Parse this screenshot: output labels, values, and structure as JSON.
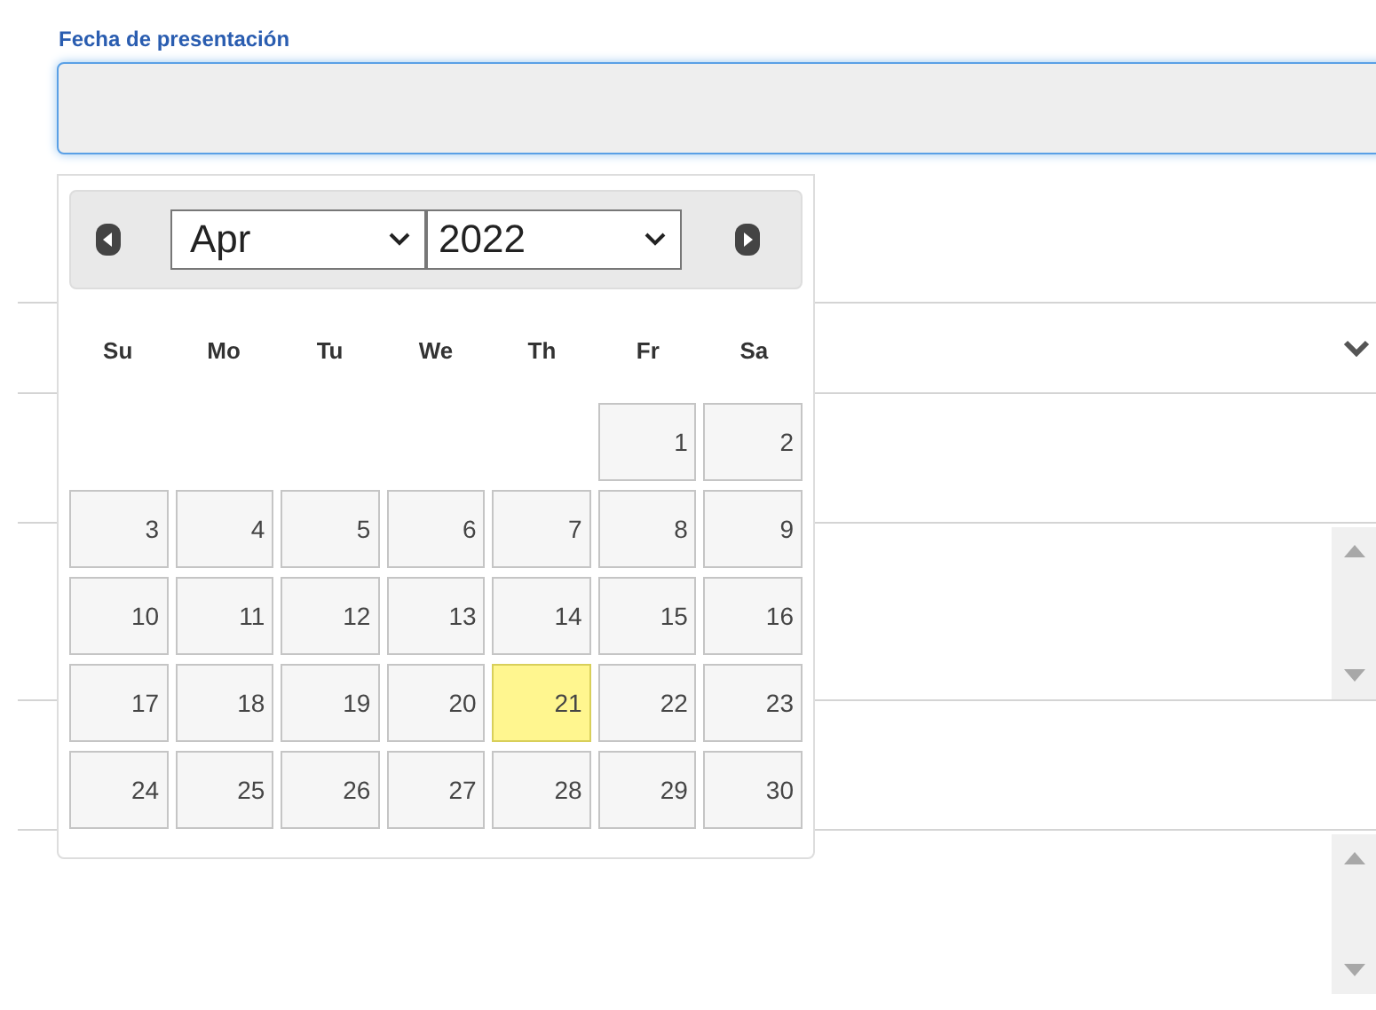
{
  "field": {
    "label": "Fecha de presentación"
  },
  "datepicker": {
    "month": "Apr",
    "year": "2022",
    "weekdays": [
      "Su",
      "Mo",
      "Tu",
      "We",
      "Th",
      "Fr",
      "Sa"
    ],
    "weeks": [
      [
        {
          "day": "1",
          "selected": false
        },
        {
          "day": "2",
          "selected": false
        }
      ],
      [
        {
          "day": "3",
          "selected": false
        },
        {
          "day": "4",
          "selected": false
        },
        {
          "day": "5",
          "selected": false
        },
        {
          "day": "6",
          "selected": false
        },
        {
          "day": "7",
          "selected": false
        },
        {
          "day": "8",
          "selected": false
        },
        {
          "day": "9",
          "selected": false
        }
      ],
      [
        {
          "day": "10",
          "selected": false
        },
        {
          "day": "11",
          "selected": false
        },
        {
          "day": "12",
          "selected": false
        },
        {
          "day": "13",
          "selected": false
        },
        {
          "day": "14",
          "selected": false
        },
        {
          "day": "15",
          "selected": false
        },
        {
          "day": "16",
          "selected": false
        }
      ],
      [
        {
          "day": "17",
          "selected": false
        },
        {
          "day": "18",
          "selected": false
        },
        {
          "day": "19",
          "selected": false
        },
        {
          "day": "20",
          "selected": false
        },
        {
          "day": "21",
          "selected": true
        },
        {
          "day": "22",
          "selected": false
        },
        {
          "day": "23",
          "selected": false
        }
      ],
      [
        {
          "day": "24",
          "selected": false
        },
        {
          "day": "25",
          "selected": false
        },
        {
          "day": "26",
          "selected": false
        },
        {
          "day": "27",
          "selected": false
        },
        {
          "day": "28",
          "selected": false
        },
        {
          "day": "29",
          "selected": false
        },
        {
          "day": "30",
          "selected": false
        }
      ]
    ]
  },
  "form_rows": [
    {
      "kind": "select"
    },
    {
      "kind": "text"
    },
    {
      "kind": "textarea"
    },
    {
      "kind": "text"
    },
    {
      "kind": "textarea"
    }
  ]
}
